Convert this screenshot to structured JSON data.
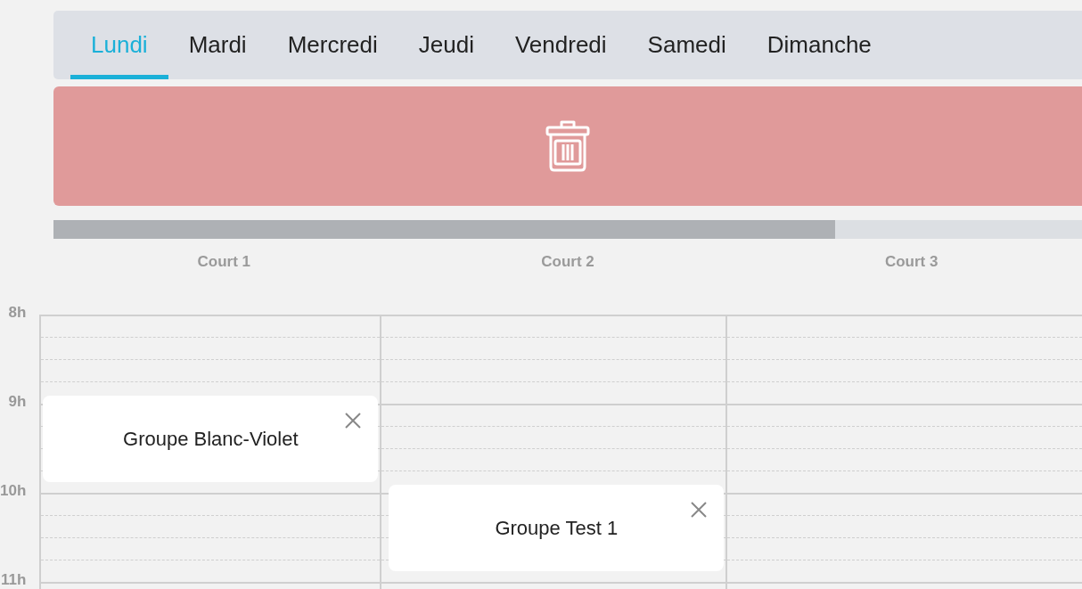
{
  "tabs": [
    {
      "label": "Lundi",
      "selected": true
    },
    {
      "label": "Mardi",
      "selected": false
    },
    {
      "label": "Mercredi",
      "selected": false
    },
    {
      "label": "Jeudi",
      "selected": false
    },
    {
      "label": "Vendredi",
      "selected": false
    },
    {
      "label": "Samedi",
      "selected": false
    },
    {
      "label": "Dimanche",
      "selected": false
    }
  ],
  "courts": [
    "Court 1",
    "Court 2",
    "Court 3"
  ],
  "hours": [
    {
      "label": "8h",
      "cells": [
        {
          "kind": "free"
        },
        {
          "kind": "free"
        },
        {
          "kind": "free"
        }
      ]
    },
    {
      "label": "9h",
      "cells": [
        {
          "kind": "booking",
          "title": "Groupe Blanc-Violet"
        },
        {
          "kind": "free"
        },
        {
          "kind": "free"
        }
      ]
    },
    {
      "label": "10h",
      "cells": [
        {
          "kind": "free"
        },
        {
          "kind": "booking",
          "title": "Groupe Test 1"
        },
        {
          "kind": "free"
        }
      ]
    },
    {
      "label": "11h",
      "cells": [
        {
          "kind": "free"
        },
        {
          "kind": "free"
        },
        {
          "kind": "free"
        }
      ]
    }
  ]
}
